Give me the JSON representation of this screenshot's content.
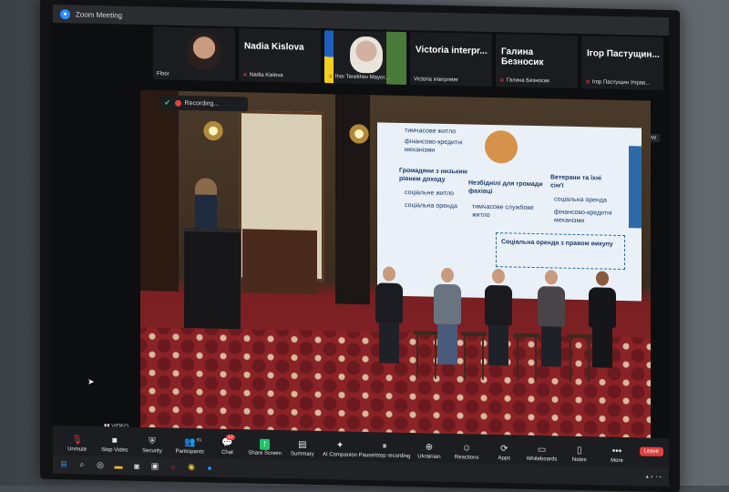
{
  "window": {
    "title": "Zoom Meeting"
  },
  "gallery": {
    "tiles": [
      {
        "name": "",
        "label": "Floor",
        "kind": "floor"
      },
      {
        "name": "Nadia Kislova",
        "label": "Nadia Kislova",
        "kind": "name"
      },
      {
        "name": "",
        "label": "Ihor Terekhov Mayor...",
        "kind": "flag"
      },
      {
        "name": "Victoria interpr...",
        "label": "Victoria interpreter",
        "kind": "name"
      },
      {
        "name": "Галина Безносик",
        "label": "Галина Безносик",
        "kind": "name"
      },
      {
        "name": "Ігор Пастущин...",
        "label": "Ігор Пастущин Управ...",
        "kind": "name"
      }
    ]
  },
  "recording": {
    "label": "Recording..."
  },
  "view_label": "View",
  "video_label": "VIDEO",
  "slide": {
    "lines": [
      {
        "text": "тимчасове житло",
        "bold": false
      },
      {
        "text": "фінансово-кредитні механізми",
        "bold": false
      },
      {
        "text": "Громадяни з низьким рівнем доходу",
        "bold": true
      },
      {
        "text": "соціальне житло",
        "bold": false
      },
      {
        "text": "соціальна оренда",
        "bold": false
      },
      {
        "text": "Незбіднілі для громади фахівці",
        "bold": true
      },
      {
        "text": "тимчасове службове житло",
        "bold": false
      },
      {
        "text": "Ветерани та їхні сім'ї",
        "bold": true
      },
      {
        "text": "соціальна оренда",
        "bold": false
      },
      {
        "text": "фінансово-кредитні механізми",
        "bold": false
      },
      {
        "text": "Соціальна оренда з правом викупу",
        "bold": true
      }
    ]
  },
  "toolbar": {
    "items": [
      {
        "label": "Unmute",
        "icon": "microphone-muted-icon",
        "glyph": "🎙",
        "kind": "red"
      },
      {
        "label": "Stop Video",
        "icon": "video-camera-icon",
        "glyph": "■",
        "kind": ""
      },
      {
        "label": "Security",
        "icon": "shield-icon",
        "glyph": "⛨",
        "kind": ""
      },
      {
        "label": "Participants",
        "icon": "participants-icon",
        "glyph": "👥",
        "kind": "",
        "count": "91"
      },
      {
        "label": "Chat",
        "icon": "chat-bubble-icon",
        "glyph": "💬",
        "kind": "",
        "badge": "12"
      },
      {
        "label": "Share Screen",
        "icon": "share-screen-icon",
        "glyph": "↑",
        "kind": "green"
      },
      {
        "label": "Summary",
        "icon": "summary-icon",
        "glyph": "▤",
        "kind": ""
      },
      {
        "label": "AI Companion",
        "icon": "sparkle-icon",
        "glyph": "✦",
        "kind": ""
      },
      {
        "label": "Pause/stop recording",
        "icon": "pause-icon",
        "glyph": "⏸",
        "kind": ""
      },
      {
        "label": "Ukrainian",
        "icon": "globe-icon",
        "glyph": "⊕",
        "kind": ""
      },
      {
        "label": "Reactions",
        "icon": "smiley-icon",
        "glyph": "☺",
        "kind": ""
      },
      {
        "label": "Apps",
        "icon": "apps-icon",
        "glyph": "⟳",
        "kind": ""
      },
      {
        "label": "Whiteboards",
        "icon": "whiteboard-icon",
        "glyph": "▭",
        "kind": ""
      },
      {
        "label": "Notes",
        "icon": "notes-icon",
        "glyph": "▯",
        "kind": ""
      },
      {
        "label": "More",
        "icon": "more-icon",
        "glyph": "•••",
        "kind": ""
      }
    ],
    "leave_label": "Leave"
  },
  "colors": {
    "zoom_blue": "#2d8cff",
    "mute_red": "#e0413f",
    "share_green": "#23c16b"
  }
}
